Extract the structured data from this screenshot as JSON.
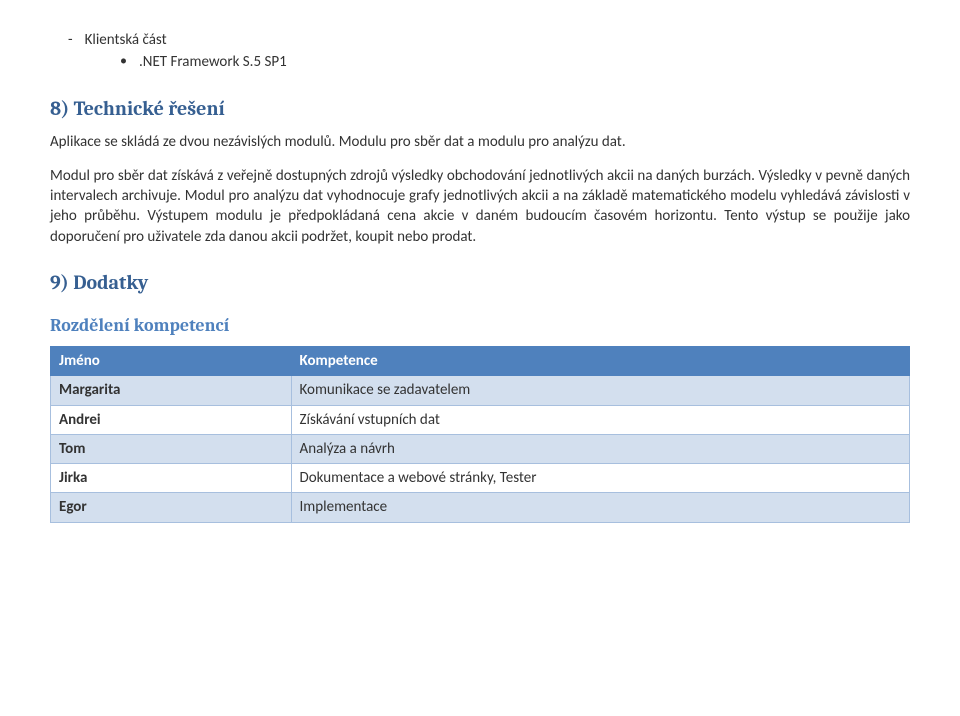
{
  "bullets": {
    "level1": {
      "text": "Klientská část"
    },
    "level2": {
      "text": ".NET Framework S.5 SP1"
    }
  },
  "section8": {
    "heading": "8) Technické řešení",
    "para1": "Aplikace se skládá ze dvou nezávislých modulů. Modulu pro sběr dat a modulu pro analýzu dat.",
    "para2": "Modul pro sběr dat získává z veřejně dostupných zdrojů výsledky obchodování jednotlivých akcii na daných burzách. Výsledky v pevně daných intervalech archivuje. Modul pro analýzu dat vyhodnocuje grafy jednotlivých akcii a na základě matematického modelu vyhledává závislosti v jeho průběhu. Výstupem modulu je předpokládaná cena akcie v daném budoucím časovém horizontu. Tento výstup se použije jako doporučení pro uživatele zda danou akcii podržet, koupit nebo prodat."
  },
  "section9": {
    "heading": "9) Dodatky",
    "subheading": "Rozdělení kompetencí",
    "table": {
      "head": {
        "c1": "Jméno",
        "c2": "Kompetence"
      },
      "rows": [
        {
          "c1": "Margarita",
          "c2": "Komunikace se zadavatelem"
        },
        {
          "c1": "Andrei",
          "c2": "Získávání vstupních dat"
        },
        {
          "c1": "Tom",
          "c2": "Analýza a návrh"
        },
        {
          "c1": "Jirka",
          "c2": "Dokumentace a webové stránky, Tester"
        },
        {
          "c1": "Egor",
          "c2": "Implementace"
        }
      ]
    }
  }
}
